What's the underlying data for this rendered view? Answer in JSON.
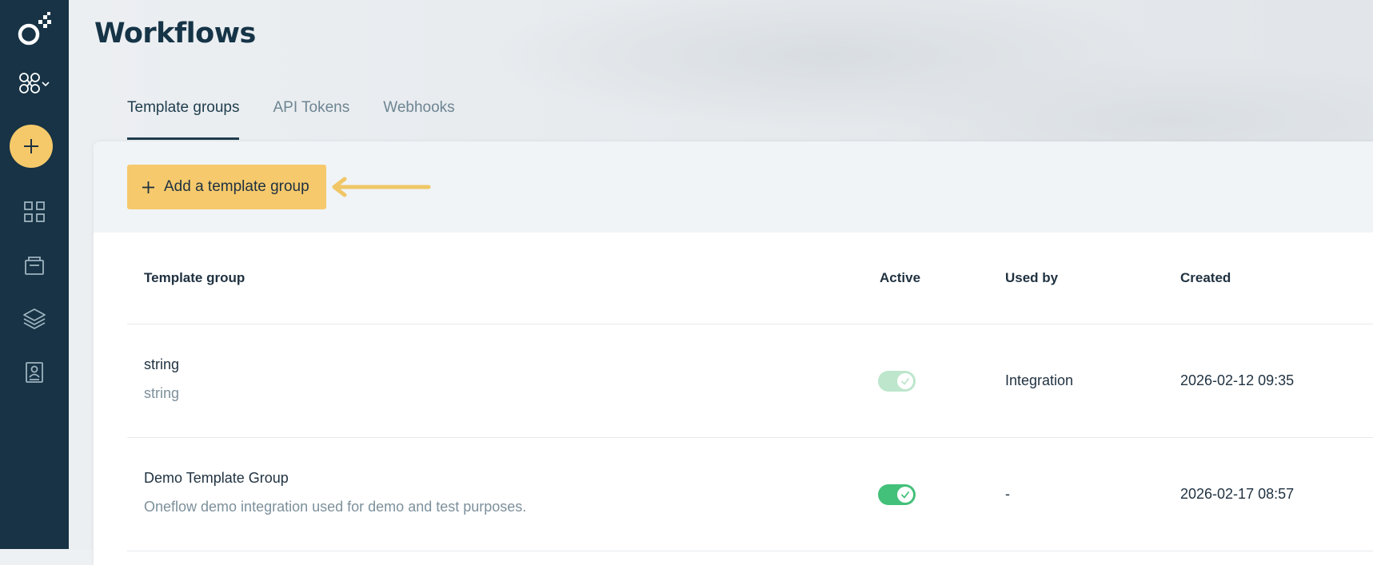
{
  "app": {
    "title": "Workflows"
  },
  "sidebar": {
    "logo": "oneflow-logo-icon",
    "workspace_icon": "workspace-switcher-icon",
    "create_icon": "plus-icon",
    "nav": [
      {
        "icon": "dashboard-grid-icon"
      },
      {
        "icon": "documents-icon"
      },
      {
        "icon": "templates-layers-icon"
      },
      {
        "icon": "contacts-book-icon"
      }
    ]
  },
  "tabs": [
    {
      "label": "Template groups",
      "active": true
    },
    {
      "label": "API Tokens",
      "active": false
    },
    {
      "label": "Webhooks",
      "active": false
    }
  ],
  "toolbar": {
    "add_label": "Add a template group"
  },
  "table": {
    "headers": {
      "template_group": "Template group",
      "active": "Active",
      "used_by": "Used by",
      "created": "Created"
    },
    "rows": [
      {
        "name": "string",
        "description": "string",
        "active": true,
        "active_disabled": true,
        "used_by": "Integration",
        "created": "2026-02-12 09:35"
      },
      {
        "name": "Demo Template Group",
        "description": "Oneflow demo integration used for demo and test purposes.",
        "active": true,
        "active_disabled": false,
        "used_by": "-",
        "created": "2026-02-17 08:57"
      }
    ]
  },
  "colors": {
    "sidebar": "#173345",
    "accent_yellow": "#f6c96c",
    "toggle_on": "#43c07a",
    "toggle_on_disabled": "#bde6cc",
    "title": "#163447"
  }
}
